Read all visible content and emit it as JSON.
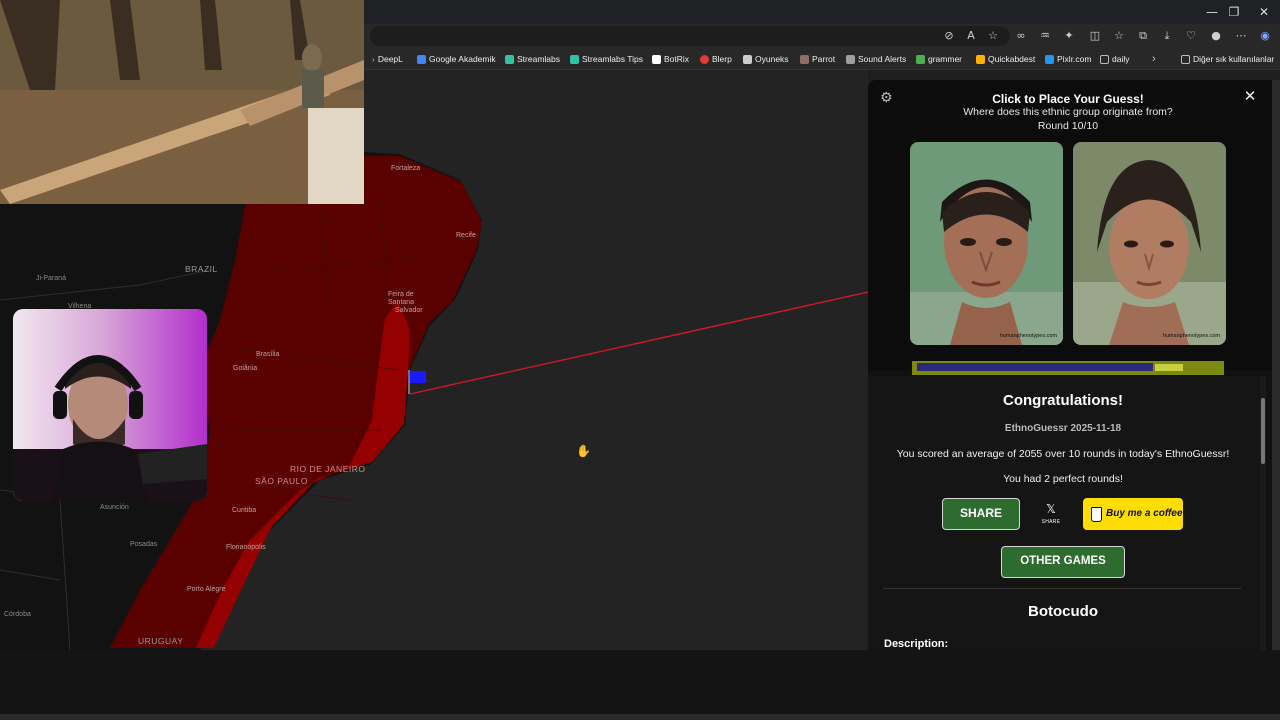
{
  "browser": {
    "bookmarks": [
      {
        "label": "DeepL",
        "color": "#0f2b46"
      },
      {
        "label": "Google Akademik",
        "color": "#4285f4"
      },
      {
        "label": "Streamlabs",
        "color": "#31c3a2"
      },
      {
        "label": "Streamlabs Tips",
        "color": "#31c3a2"
      },
      {
        "label": "BotRix",
        "color": "#ffffff"
      },
      {
        "label": "Blerp",
        "color": "#e53935"
      },
      {
        "label": "Oyuneks",
        "color": "#cccccc"
      },
      {
        "label": "Parrot",
        "color": "#8d6e63"
      },
      {
        "label": "Sound Alerts",
        "color": "#9e9e9e"
      },
      {
        "label": "grammer",
        "color": "#4caf50"
      },
      {
        "label": "Quickabdest",
        "color": "#ffb300"
      },
      {
        "label": "Pixlr.com",
        "color": "#2196f3"
      },
      {
        "label": "daily",
        "color": "#bbbbbb"
      }
    ],
    "other_bookmarks": "Diğer sık kullanılanlar",
    "icons": {
      "minimize": "minimize-icon",
      "restore": "restore-icon",
      "close": "close-icon",
      "overflow": "chevron-right-icon",
      "menu": "more-icon"
    }
  },
  "map": {
    "cities": [
      {
        "name": "Fortaleza",
        "highlight": true
      },
      {
        "name": "Recife",
        "highlight": true
      },
      {
        "name": "Ji-Paraná",
        "highlight": false
      },
      {
        "name": "Vilhena",
        "highlight": false
      },
      {
        "name": "Feira de Santana",
        "highlight": true
      },
      {
        "name": "Salvador",
        "highlight": true
      },
      {
        "name": "Brasília",
        "highlight": true
      },
      {
        "name": "Goiânia",
        "highlight": true
      },
      {
        "name": "Asunción",
        "highlight": false
      },
      {
        "name": "Posadas",
        "highlight": false
      },
      {
        "name": "Curitiba",
        "highlight": true
      },
      {
        "name": "Florianópolis",
        "highlight": true
      },
      {
        "name": "Porto Alegre",
        "highlight": true
      },
      {
        "name": "Córdoba",
        "highlight": false
      }
    ],
    "regions": {
      "brazil": "BRAZIL",
      "rio": "RIO DE JANEIRO",
      "saopaulo": "SÃO PAULO",
      "uruguay": "URUGUAY"
    },
    "colors": {
      "highlight": "#6b0000",
      "land": "#111111",
      "water": "#232323",
      "guess_line": "#d0182a",
      "flag": "#1a1aff"
    }
  },
  "panel": {
    "title": "Click to Place Your Guess!",
    "subtitle": "Where does this ethnic group originate from?",
    "round": "Round 10/10",
    "face_credit": "humanphenotypes.com",
    "congrats": "Congratulations!",
    "game_id": "EthnoGuessr 2025-11-18",
    "score_line": "You scored an average of 2055 over 10 rounds in today's EthnoGuessr!",
    "perfect_line": "You had 2 perfect rounds!",
    "share_label": "SHARE",
    "x_glyph": "𝕏",
    "x_share_label": "SHARE",
    "coffee_label": "Buy me a coffee",
    "other_games_label": "OTHER GAMES",
    "ethnic_group": "Botocudo",
    "description_label": "Description:",
    "result_fraction": 0.78
  }
}
